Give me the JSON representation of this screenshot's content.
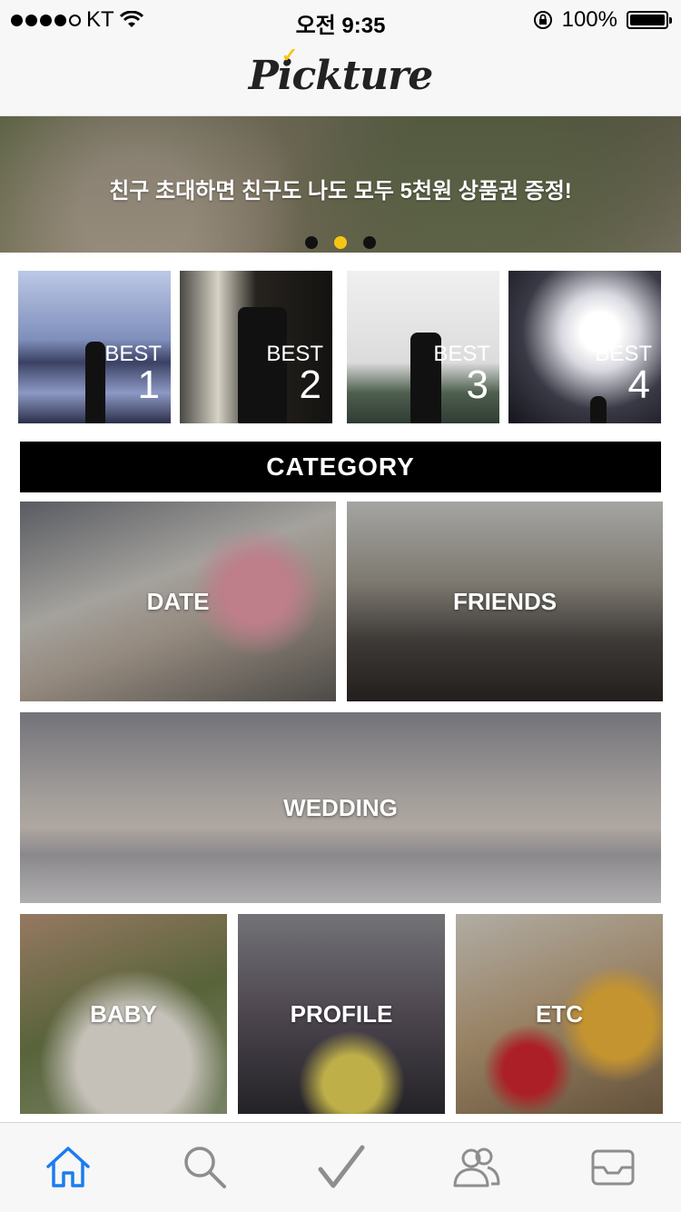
{
  "status_bar": {
    "carrier": "KT",
    "time": "오전 9:35",
    "battery": "100%"
  },
  "header": {
    "logo_text": "Pickture",
    "logo_check": "✓"
  },
  "banner": {
    "text": "친구 초대하면 친구도 나도 모두 5천원 상품권 증정!",
    "active_page": 2,
    "page_count": 3
  },
  "best": [
    {
      "label": "BEST",
      "rank": "1"
    },
    {
      "label": "BEST",
      "rank": "2"
    },
    {
      "label": "BEST",
      "rank": "3"
    },
    {
      "label": "BEST",
      "rank": "4"
    }
  ],
  "category": {
    "title": "CATEGORY",
    "items": [
      {
        "label": "DATE"
      },
      {
        "label": "FRIENDS"
      },
      {
        "label": "WEDDING"
      },
      {
        "label": "BABY"
      },
      {
        "label": "PROFILE"
      },
      {
        "label": "ETC"
      }
    ]
  },
  "tabs": [
    {
      "icon": "home-icon",
      "active": true
    },
    {
      "icon": "search-icon",
      "active": false
    },
    {
      "icon": "check-icon",
      "active": false
    },
    {
      "icon": "users-icon",
      "active": false
    },
    {
      "icon": "inbox-icon",
      "active": false
    }
  ],
  "colors": {
    "accent": "#f6c616",
    "active_tab": "#1a7cf0",
    "inactive_tab": "#8e8e8e"
  }
}
